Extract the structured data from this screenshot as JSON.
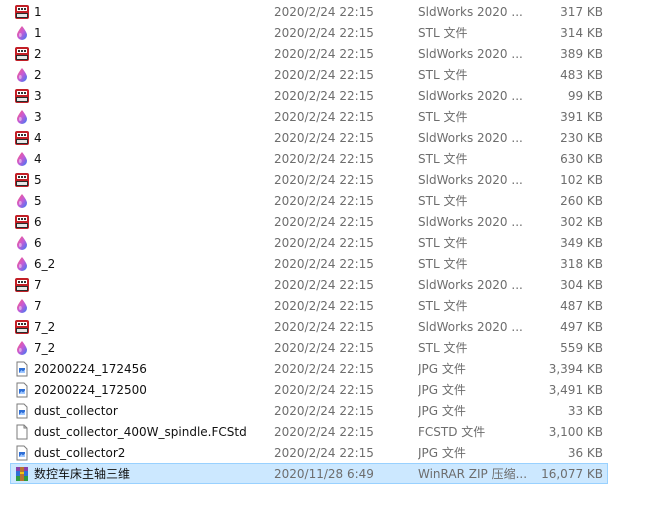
{
  "files": [
    {
      "name": "1",
      "date": "2020/2/24 22:15",
      "type": "SldWorks 2020 ...",
      "size": "317 KB",
      "icon": "solidworks-icon"
    },
    {
      "name": "1",
      "date": "2020/2/24 22:15",
      "type": "STL 文件",
      "size": "314 KB",
      "icon": "stl-icon"
    },
    {
      "name": "2",
      "date": "2020/2/24 22:15",
      "type": "SldWorks 2020 ...",
      "size": "389 KB",
      "icon": "solidworks-icon"
    },
    {
      "name": "2",
      "date": "2020/2/24 22:15",
      "type": "STL 文件",
      "size": "483 KB",
      "icon": "stl-icon"
    },
    {
      "name": "3",
      "date": "2020/2/24 22:15",
      "type": "SldWorks 2020 ...",
      "size": "99 KB",
      "icon": "solidworks-icon"
    },
    {
      "name": "3",
      "date": "2020/2/24 22:15",
      "type": "STL 文件",
      "size": "391 KB",
      "icon": "stl-icon"
    },
    {
      "name": "4",
      "date": "2020/2/24 22:15",
      "type": "SldWorks 2020 ...",
      "size": "230 KB",
      "icon": "solidworks-icon"
    },
    {
      "name": "4",
      "date": "2020/2/24 22:15",
      "type": "STL 文件",
      "size": "630 KB",
      "icon": "stl-icon"
    },
    {
      "name": "5",
      "date": "2020/2/24 22:15",
      "type": "SldWorks 2020 ...",
      "size": "102 KB",
      "icon": "solidworks-icon"
    },
    {
      "name": "5",
      "date": "2020/2/24 22:15",
      "type": "STL 文件",
      "size": "260 KB",
      "icon": "stl-icon"
    },
    {
      "name": "6",
      "date": "2020/2/24 22:15",
      "type": "SldWorks 2020 ...",
      "size": "302 KB",
      "icon": "solidworks-icon"
    },
    {
      "name": "6",
      "date": "2020/2/24 22:15",
      "type": "STL 文件",
      "size": "349 KB",
      "icon": "stl-icon"
    },
    {
      "name": "6_2",
      "date": "2020/2/24 22:15",
      "type": "STL 文件",
      "size": "318 KB",
      "icon": "stl-icon"
    },
    {
      "name": "7",
      "date": "2020/2/24 22:15",
      "type": "SldWorks 2020 ...",
      "size": "304 KB",
      "icon": "solidworks-icon"
    },
    {
      "name": "7",
      "date": "2020/2/24 22:15",
      "type": "STL 文件",
      "size": "487 KB",
      "icon": "stl-icon"
    },
    {
      "name": "7_2",
      "date": "2020/2/24 22:15",
      "type": "SldWorks 2020 ...",
      "size": "497 KB",
      "icon": "solidworks-icon"
    },
    {
      "name": "7_2",
      "date": "2020/2/24 22:15",
      "type": "STL 文件",
      "size": "559 KB",
      "icon": "stl-icon"
    },
    {
      "name": "20200224_172456",
      "date": "2020/2/24 22:15",
      "type": "JPG 文件",
      "size": "3,394 KB",
      "icon": "image-file-icon"
    },
    {
      "name": "20200224_172500",
      "date": "2020/2/24 22:15",
      "type": "JPG 文件",
      "size": "3,491 KB",
      "icon": "image-file-icon"
    },
    {
      "name": "dust_collector",
      "date": "2020/2/24 22:15",
      "type": "JPG 文件",
      "size": "33 KB",
      "icon": "image-file-icon"
    },
    {
      "name": "dust_collector_400W_spindle.FCStd",
      "date": "2020/2/24 22:15",
      "type": "FCSTD 文件",
      "size": "3,100 KB",
      "icon": "blank-file-icon"
    },
    {
      "name": "dust_collector2",
      "date": "2020/2/24 22:15",
      "type": "JPG 文件",
      "size": "36 KB",
      "icon": "image-file-icon"
    },
    {
      "name": "数控车床主轴三维",
      "date": "2020/11/28 6:49",
      "type": "WinRAR ZIP 压缩...",
      "size": "16,077 KB",
      "icon": "winrar-archive-icon",
      "selected": true
    }
  ],
  "colors": {
    "selection_fill": "#cce8ff",
    "selection_border": "#99d1ff",
    "secondary_text": "#6d6d6d"
  }
}
